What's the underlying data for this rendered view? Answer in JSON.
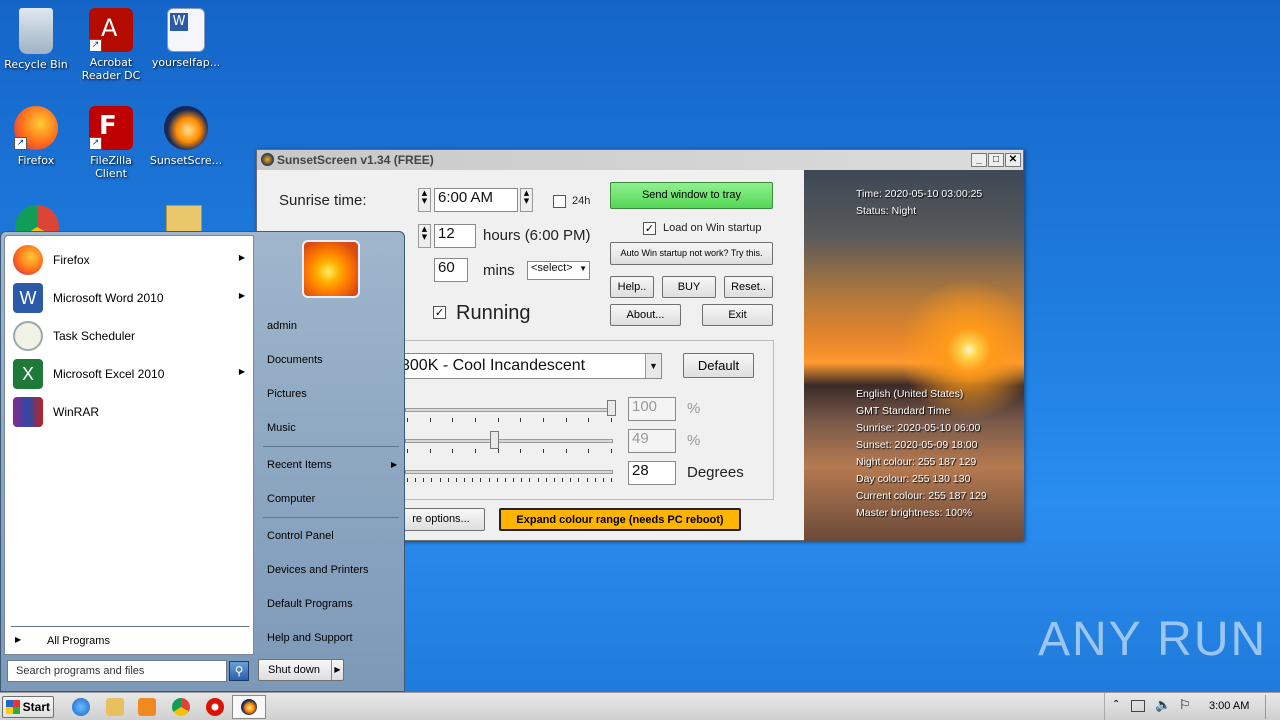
{
  "desktop": {
    "icons": [
      {
        "label": "Recycle Bin"
      },
      {
        "label": "Acrobat Reader DC"
      },
      {
        "label": "yourselfap..."
      },
      {
        "label": "Firefox"
      },
      {
        "label": "FileZilla Client"
      },
      {
        "label": "SunsetScre..."
      }
    ]
  },
  "app": {
    "title": "SunsetScreen v1.34 (FREE)",
    "sunrise_label": "Sunrise time:",
    "sunrise_value": "6:00 AM",
    "h24_label": "24h",
    "hours_value": "12",
    "hours_label": "hours  (6:00 PM)",
    "mins_value": "60",
    "mins_label": "mins",
    "select_value": "<select>",
    "running_label": "Running",
    "send_tray": "Send window to tray",
    "load_startup": "Load on Win startup",
    "auto_startup": "Auto Win startup not work? Try this.",
    "help": "Help..",
    "buy": "BUY",
    "reset": "Reset..",
    "about": "About...",
    "exit": "Exit",
    "preset": "300K - Cool Incandescent",
    "default": "Default",
    "slider1_value": "100",
    "slider1_unit": "%",
    "slider2_value": "49",
    "slider2_unit": "%",
    "slider3_value": "28",
    "slider3_unit": "Degrees",
    "more_options": "re options...",
    "expand": "Expand colour range (needs PC reboot)",
    "info": {
      "time": "Time: 2020-05-10 03:00:25",
      "status": "Status: Night",
      "lang": "English (United States)",
      "tz": "GMT Standard Time",
      "sunrise": "Sunrise: 2020-05-10 06:00",
      "sunset": "Sunset: 2020-05-09 18:00",
      "night": "Night colour: 255 187 129",
      "day": "Day colour: 255 130 130",
      "current": "Current colour: 255 187 129",
      "brightness": "Master brightness: 100%"
    }
  },
  "start_menu": {
    "programs": [
      {
        "label": "Firefox"
      },
      {
        "label": "Microsoft Word 2010"
      },
      {
        "label": "Task Scheduler"
      },
      {
        "label": "Microsoft Excel 2010"
      },
      {
        "label": "WinRAR"
      }
    ],
    "all_programs": "All Programs",
    "search_placeholder": "Search programs and files",
    "right": {
      "user": "admin",
      "documents": "Documents",
      "pictures": "Pictures",
      "music": "Music",
      "recent": "Recent Items",
      "computer": "Computer",
      "control": "Control Panel",
      "devices": "Devices and Printers",
      "defaults": "Default Programs",
      "help": "Help and Support"
    },
    "shutdown": "Shut down"
  },
  "taskbar": {
    "start": "Start",
    "clock": "3:00 AM"
  },
  "watermark": "ANY RUN"
}
